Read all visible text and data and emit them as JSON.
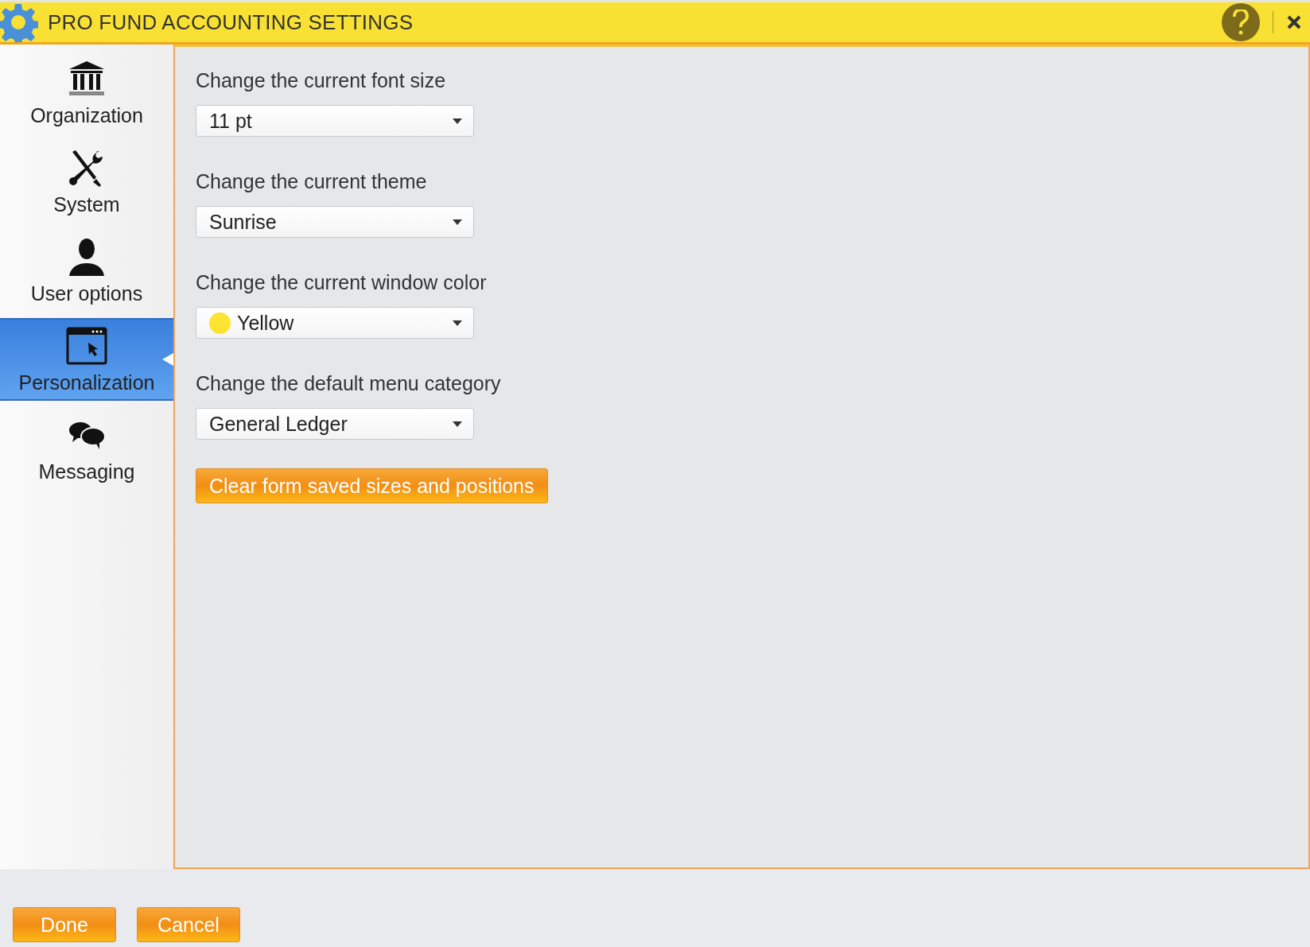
{
  "window": {
    "title": "PRO FUND ACCOUNTING SETTINGS"
  },
  "sidebar": {
    "items": [
      {
        "label": "Organization",
        "kind": "bank",
        "selected": false
      },
      {
        "label": "System",
        "kind": "tools",
        "selected": false
      },
      {
        "label": "User options",
        "kind": "person",
        "selected": false
      },
      {
        "label": "Personalization",
        "kind": "window",
        "selected": true
      },
      {
        "label": "Messaging",
        "kind": "chat",
        "selected": false
      }
    ]
  },
  "settings": [
    {
      "label": "Change the current font size",
      "value": "11 pt"
    },
    {
      "label": "Change the current theme",
      "value": "Sunrise"
    },
    {
      "label": "Change the current window color",
      "value": "Yellow",
      "color": "#fde332"
    },
    {
      "label": "Change the default menu category",
      "value": "General Ledger"
    }
  ],
  "clear_button": "Clear form saved sizes and positions",
  "buttons": [
    "Done",
    "Cancel"
  ]
}
